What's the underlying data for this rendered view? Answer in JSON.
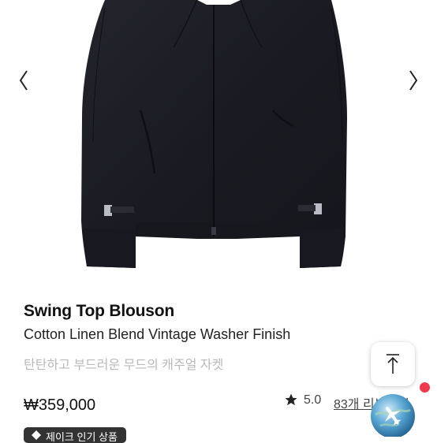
{
  "product": {
    "name": "Swing Top Blouson",
    "subtitle": "Cotton Linen Blend Vintage Washer Finish",
    "description_kr": "탄탄하고 부드러운 무드의 캐주얼 자켓",
    "price": "₩359,000",
    "rating": "5.0",
    "reviews": "83개 리뷰보기"
  },
  "badge": {
    "text": "제이크 인기 상품"
  },
  "icons": {
    "prev": "chevron-left-icon",
    "next": "chevron-right-icon",
    "star": "star-icon",
    "scroll_top": "arrow-up-icon",
    "travel": "airplane-globe-icon"
  },
  "colors": {
    "jacket": "#1b1c23",
    "notify_dot": "#f0394f",
    "badge_bg": "#333333",
    "muted_text": "#b9b9b9"
  }
}
